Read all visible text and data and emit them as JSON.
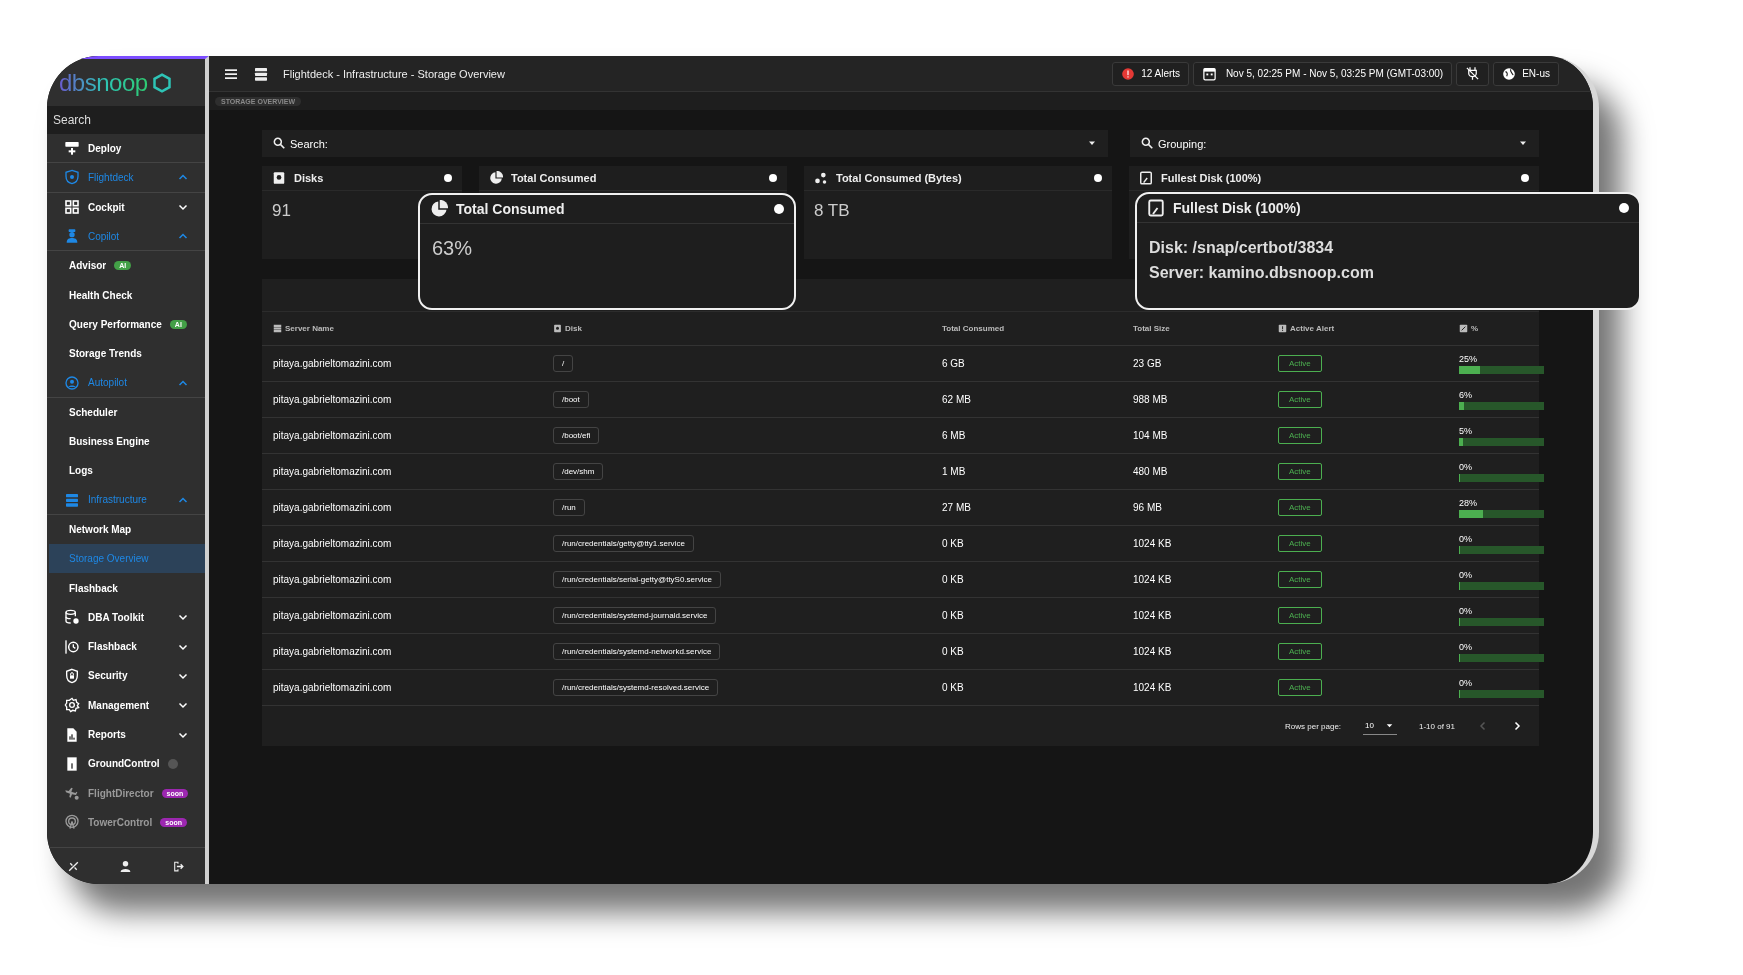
{
  "sidebar": {
    "logo": "dbsnoop",
    "search": {
      "placeholder": "Search"
    },
    "items": [
      {
        "kind": "item",
        "label": "Deploy",
        "selected": false,
        "disabled": false
      },
      {
        "kind": "section",
        "label": "Flightdeck",
        "expanded": true,
        "selected": false,
        "disabled": false
      },
      {
        "kind": "item",
        "label": "Cockpit",
        "expanded": false,
        "selected": false,
        "disabled": false
      },
      {
        "kind": "section",
        "label": "Copilot",
        "expanded": true,
        "selected": false,
        "disabled": false
      },
      {
        "kind": "sub",
        "label": "Advisor",
        "badge": {
          "text": "AI",
          "color": "#43a047"
        },
        "selected": false,
        "disabled": false
      },
      {
        "kind": "sub",
        "label": "Health Check",
        "selected": false,
        "disabled": false
      },
      {
        "kind": "sub",
        "label": "Query Performance",
        "badge": {
          "text": "AI",
          "color": "#43a047"
        },
        "selected": false,
        "disabled": false
      },
      {
        "kind": "sub",
        "label": "Storage Trends",
        "selected": false,
        "disabled": false
      },
      {
        "kind": "section",
        "label": "Autopilot",
        "expanded": true,
        "selected": false,
        "disabled": false
      },
      {
        "kind": "sub",
        "label": "Scheduler",
        "selected": false,
        "disabled": false
      },
      {
        "kind": "sub",
        "label": "Business Engine",
        "selected": false,
        "disabled": false
      },
      {
        "kind": "sub",
        "label": "Logs",
        "selected": false,
        "disabled": false
      },
      {
        "kind": "section",
        "label": "Infrastructure",
        "expanded": true,
        "selected": false,
        "disabled": false
      },
      {
        "kind": "sub",
        "label": "Network Map",
        "selected": false,
        "disabled": false
      },
      {
        "kind": "sub",
        "label": "Storage Overview",
        "selected": true,
        "disabled": false
      },
      {
        "kind": "sub",
        "label": "Flashback",
        "selected": false,
        "disabled": false
      },
      {
        "kind": "item",
        "label": "DBA Toolkit",
        "expanded": false,
        "selected": false,
        "disabled": false
      },
      {
        "kind": "item",
        "label": "Flashback",
        "expanded": false,
        "selected": false,
        "disabled": false
      },
      {
        "kind": "item",
        "label": "Security",
        "expanded": false,
        "selected": false,
        "disabled": false
      },
      {
        "kind": "item",
        "label": "Management",
        "expanded": false,
        "selected": false,
        "disabled": false
      },
      {
        "kind": "item",
        "label": "Reports",
        "expanded": false,
        "selected": false,
        "disabled": false
      },
      {
        "kind": "item",
        "label": "GroundControl",
        "status_dot": true,
        "selected": false,
        "disabled": false
      },
      {
        "kind": "item",
        "label": "FlightDirector",
        "badge": {
          "text": "soon",
          "color": "#9c27b0"
        },
        "selected": false,
        "disabled": true
      },
      {
        "kind": "item",
        "label": "TowerControl",
        "badge": {
          "text": "soon",
          "color": "#9c27b0"
        },
        "selected": false,
        "disabled": true
      }
    ]
  },
  "topbar": {
    "title": "Flightdeck - Infrastructure - Storage Overview",
    "alerts": "12 Alerts",
    "date_range": "Nov 5, 02:25 PM - Nov 5, 03:25 PM (GMT-03:00)",
    "language": "EN-us"
  },
  "breadcrumb": "STORAGE OVERVIEW",
  "filters": {
    "search": {
      "placeholder": "Search:"
    },
    "grouping": {
      "placeholder": "Grouping:"
    }
  },
  "stat_cards": [
    {
      "title": "Disks",
      "value": "91"
    },
    {
      "title": "Total Consumed"
    },
    {
      "title": "Total Consumed (Bytes)",
      "value": "8 TB"
    },
    {
      "title": "Fullest Disk (100%)"
    }
  ],
  "callouts": [
    {
      "title": "Total Consumed",
      "lines": [
        "63%"
      ]
    },
    {
      "title": "Fullest Disk (100%)",
      "lines": [
        "Disk: /snap/certbot/3834",
        "Server: kamino.dbsnoop.com"
      ]
    }
  ],
  "table": {
    "columns": [
      "Server Name",
      "Disk",
      "Total Consumed",
      "Total Size",
      "Active Alert",
      "%"
    ],
    "rows": [
      {
        "server": "pitaya.gabrieltomazini.com",
        "disk": "/",
        "consumed": "6 GB",
        "size": "23 GB",
        "alert": "Active",
        "percent": "25%",
        "level": 0.25
      },
      {
        "server": "pitaya.gabrieltomazini.com",
        "disk": "/boot",
        "consumed": "62 MB",
        "size": "988 MB",
        "alert": "Active",
        "percent": "6%",
        "level": 0.06
      },
      {
        "server": "pitaya.gabrieltomazini.com",
        "disk": "/boot/efi",
        "consumed": "6 MB",
        "size": "104 MB",
        "alert": "Active",
        "percent": "5%",
        "level": 0.05
      },
      {
        "server": "pitaya.gabrieltomazini.com",
        "disk": "/dev/shm",
        "consumed": "1 MB",
        "size": "480 MB",
        "alert": "Active",
        "percent": "0%",
        "level": 0.005
      },
      {
        "server": "pitaya.gabrieltomazini.com",
        "disk": "/run",
        "consumed": "27 MB",
        "size": "96 MB",
        "alert": "Active",
        "percent": "28%",
        "level": 0.28
      },
      {
        "server": "pitaya.gabrieltomazini.com",
        "disk": "/run/credentials/getty@tty1.service",
        "consumed": "0 KB",
        "size": "1024 KB",
        "alert": "Active",
        "percent": "0%",
        "level": 0
      },
      {
        "server": "pitaya.gabrieltomazini.com",
        "disk": "/run/credentials/serial-getty@ttyS0.service",
        "consumed": "0 KB",
        "size": "1024 KB",
        "alert": "Active",
        "percent": "0%",
        "level": 0
      },
      {
        "server": "pitaya.gabrieltomazini.com",
        "disk": "/run/credentials/systemd-journald.service",
        "consumed": "0 KB",
        "size": "1024 KB",
        "alert": "Active",
        "percent": "0%",
        "level": 0
      },
      {
        "server": "pitaya.gabrieltomazini.com",
        "disk": "/run/credentials/systemd-networkd.service",
        "consumed": "0 KB",
        "size": "1024 KB",
        "alert": "Active",
        "percent": "0%",
        "level": 0
      },
      {
        "server": "pitaya.gabrieltomazini.com",
        "disk": "/run/credentials/systemd-resolved.service",
        "consumed": "0 KB",
        "size": "1024 KB",
        "alert": "Active",
        "percent": "0%",
        "level": 0
      }
    ]
  },
  "pagination": {
    "rows_per_page_label": "Rows per page:",
    "rows_per_page": "10",
    "range": "1-10 of 91",
    "prev_disabled": true
  }
}
